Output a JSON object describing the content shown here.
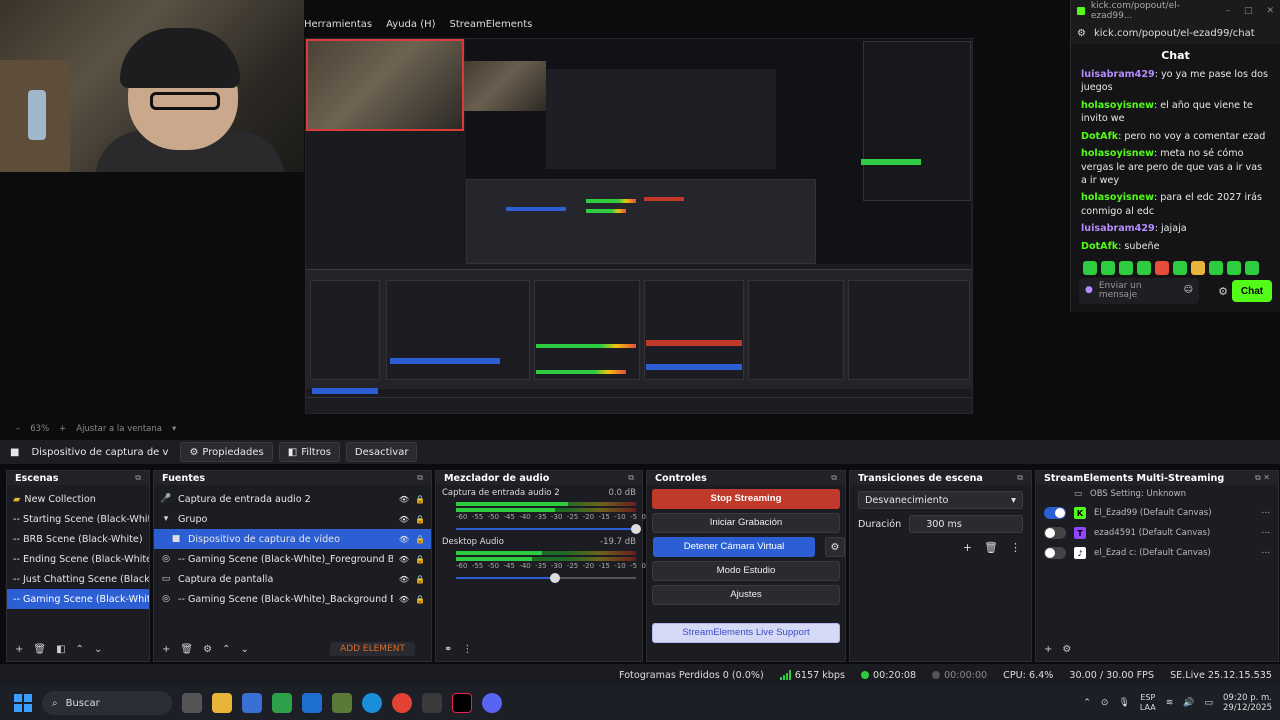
{
  "preview_menu": [
    "Herramientas",
    "Ayuda (H)",
    "StreamElements"
  ],
  "zoom": {
    "percent": "63%",
    "fit_label": "Ajustar a la ventana"
  },
  "source_toolbar": {
    "source_name": "Dispositivo de captura de v",
    "properties": "Propiedades",
    "filters": "Filtros",
    "deactivate": "Desactivar"
  },
  "scenes": {
    "title": "Escenas",
    "items": [
      "New Collection",
      "-- Starting Scene (Black-White)",
      "-- BRB Scene (Black-White)",
      "-- Ending Scene (Black-White)",
      "-- Just Chatting Scene (Black-White",
      "-- Gaming Scene (Black-White)"
    ],
    "selected_index": 5
  },
  "sources": {
    "title": "Fuentes",
    "items": [
      {
        "label": "Captura de entrada audio 2",
        "icon": "microphone-icon",
        "indent": 0
      },
      {
        "label": "Grupo",
        "icon": "folder-icon",
        "indent": 0
      },
      {
        "label": "Dispositivo de captura de vídeo",
        "icon": "camera-icon",
        "indent": 1
      },
      {
        "label": "-- Gaming Scene (Black-White)_Foreground Browser Sou",
        "icon": "globe-icon",
        "indent": 0
      },
      {
        "label": "Captura de pantalla",
        "icon": "monitor-icon",
        "indent": 0
      },
      {
        "label": "-- Gaming Scene (Black-White)_Background Browser Sou",
        "icon": "globe-icon",
        "indent": 0
      }
    ],
    "selected_index": 2,
    "add_element": "ADD ELEMENT"
  },
  "mixer": {
    "title": "Mezclador de audio",
    "tracks": [
      {
        "name": "Captura de entrada audio 2",
        "db": "0.0 dB",
        "level1": 0.62,
        "level2": 0.55,
        "volume": 1.0
      },
      {
        "name": "Desktop Audio",
        "db": "-19.7 dB",
        "level1": 0.48,
        "level2": 0.42,
        "volume": 0.55
      }
    ],
    "ticks": [
      "-60",
      "-55",
      "-50",
      "-45",
      "-40",
      "-35",
      "-30",
      "-25",
      "-20",
      "-15",
      "-10",
      "-5",
      "0"
    ]
  },
  "controls": {
    "title": "Controles",
    "stop_streaming": "Stop Streaming",
    "start_recording": "Iniciar Grabación",
    "stop_virtual_cam": "Detener Cámara Virtual",
    "studio_mode": "Modo Estudio",
    "settings": "Ajustes",
    "se_support": "StreamElements Live Support"
  },
  "transitions": {
    "title": "Transiciones de escena",
    "selected": "Desvanecimiento",
    "duration_label": "Duración",
    "duration_value": "300 ms"
  },
  "multistreaming": {
    "title": "StreamElements Multi-Streaming",
    "obs_setting": "OBS Setting: Unknown",
    "rows": [
      {
        "name": "El_Ezad99 (Default Canvas)",
        "platform": "kick",
        "color": "#53fc18",
        "on": true
      },
      {
        "name": "ezad4591 (Default Canvas)",
        "platform": "twitch",
        "color": "#9146ff",
        "on": false
      },
      {
        "name": "el_Ezad c: (Default Canvas)",
        "platform": "tiktok",
        "color": "#ffffff",
        "on": false
      }
    ]
  },
  "status": {
    "dropped_frames": "Fotogramas Perdidos 0 (0.0%)",
    "bitrate": "6157 kbps",
    "stream_time": "00:20:08",
    "rec_time": "00:00:00",
    "cpu": "CPU: 6.4%",
    "fps": "30.00 / 30.00 FPS",
    "version": "SE.Live 25.12.15.535"
  },
  "chat": {
    "window_url": "kick.com/popout/el-ezad99...",
    "url": "kick.com/popout/el-ezad99/chat",
    "header": "Chat",
    "messages": [
      {
        "user": "luisabram429",
        "color": "#b58cff",
        "text": "yo ya me pase los dos juegos"
      },
      {
        "user": "holasoyisnew",
        "color": "#53fc18",
        "text": "el año que viene te invito we"
      },
      {
        "user": "DotAfk",
        "color": "#53fc18",
        "text": "pero no voy a comentar ezad"
      },
      {
        "user": "holasoyisnew",
        "color": "#53fc18",
        "text": "meta no sé cómo vergas le are pero de que vas a ir vas a ir wey"
      },
      {
        "user": "holasoyisnew",
        "color": "#53fc18",
        "text": "para el edc 2027 irás conmigo al edc"
      },
      {
        "user": "luisabram429",
        "color": "#b58cff",
        "text": "jajaja"
      },
      {
        "user": "DotAfk",
        "color": "#53fc18",
        "text": "subeñe"
      }
    ],
    "input_placeholder": "Enviar un mensaje",
    "send": "Chat"
  },
  "taskbar": {
    "search": "Buscar",
    "lang_top": "ESP",
    "lang_bottom": "LAA",
    "time": "09:20 p. m.",
    "date": "29/12/2025"
  }
}
